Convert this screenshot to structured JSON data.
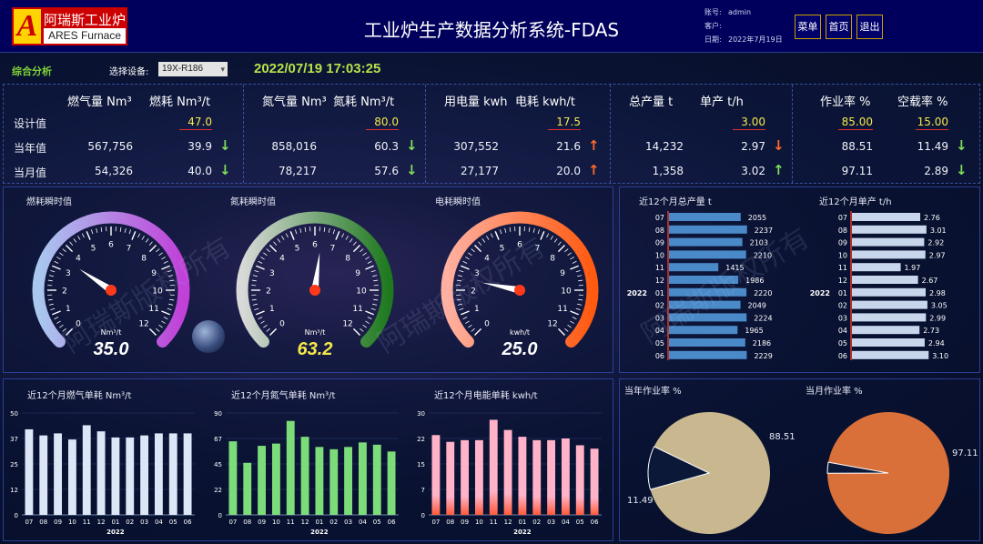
{
  "header": {
    "logo_char": "A",
    "logo_cn": "阿瑞斯工业炉",
    "logo_en": "ARES Furnace",
    "title": "工业炉生产数据分析系统-FDAS",
    "account_label": "账号:",
    "account": "admin",
    "client_label": "客户:",
    "client": "",
    "date_label": "日期:",
    "date": "2022年7月19日",
    "buttons": [
      "菜单",
      "首页",
      "退出"
    ]
  },
  "toolbar": {
    "section": "综合分析",
    "select_label": "选择设备:",
    "device": "19X-R186",
    "datetime": "2022/07/19 17:03:25"
  },
  "summary": {
    "row_labels": [
      "设计值",
      "当年值",
      "当月值"
    ],
    "groups": [
      {
        "h1": "燃气量 Nm³",
        "h2": "燃耗 Nm³/t",
        "design": "47.0",
        "year_q": "567,756",
        "year_r": "39.9",
        "year_dir": "down",
        "month_q": "54,326",
        "month_r": "40.0",
        "month_dir": "down"
      },
      {
        "h1": "氮气量 Nm³",
        "h2": "氮耗 Nm³/t",
        "design": "80.0",
        "year_q": "858,016",
        "year_r": "60.3",
        "year_dir": "down",
        "month_q": "78,217",
        "month_r": "57.6",
        "month_dir": "down"
      },
      {
        "h1": "用电量 kwh",
        "h2": "电耗 kwh/t",
        "design": "17.5",
        "year_q": "307,552",
        "year_r": "21.6",
        "year_dir": "up",
        "month_q": "27,177",
        "month_r": "20.0",
        "month_dir": "up"
      },
      {
        "h1": "总产量 t",
        "h2": "单产 t/h",
        "design": "3.00",
        "year_q": "14,232",
        "year_r": "2.97",
        "year_dir": "down_red",
        "month_q": "1,358",
        "month_r": "3.02",
        "month_dir": "up_green"
      },
      {
        "h1": "作业率 %",
        "h2": "空载率 %",
        "design_a": "85.00",
        "design": "15.00",
        "year_q": "88.51",
        "year_r": "11.49",
        "year_dir": "down",
        "month_q": "97.11",
        "month_r": "2.89",
        "month_dir": "down"
      }
    ]
  },
  "gauges": [
    {
      "title": "燃耗瞬时值",
      "unit": "Nm³/t",
      "value": 35.0,
      "display": "35.0",
      "max": 120,
      "ticks": [
        "0",
        "1",
        "2",
        "3",
        "4",
        "5",
        "6",
        "7",
        "8",
        "9",
        "10",
        "11",
        "12"
      ],
      "color_start": "#a9c8ef",
      "color_end": "#c040d8",
      "value_color": "#ffffff"
    },
    {
      "title": "氮耗瞬时值",
      "unit": "Nm³/t",
      "value": 63.2,
      "display": "63.2",
      "max": 120,
      "ticks": [
        "0",
        "1",
        "2",
        "3",
        "4",
        "5",
        "6",
        "7",
        "8",
        "9",
        "10",
        "11",
        "12"
      ],
      "color_start": "#d9d9d9",
      "color_end": "#1f7a1f",
      "value_color": "#f5e84a"
    },
    {
      "title": "电耗瞬时值",
      "unit": "kwh/t",
      "value": 25.0,
      "display": "25.0",
      "max": 120,
      "ticks": [
        "0",
        "1",
        "2",
        "3",
        "4",
        "5",
        "6",
        "7",
        "8",
        "9",
        "10",
        "11",
        "12"
      ],
      "color_start": "#ffb0a0",
      "color_end": "#ff5a10",
      "value_color": "#ffffff"
    }
  ],
  "hbar": {
    "months": [
      "07",
      "08",
      "09",
      "10",
      "11",
      "12",
      "01",
      "02",
      "03",
      "04",
      "05",
      "06"
    ],
    "year_label": "2022",
    "total": {
      "title": "近12个月总产量 t",
      "values": [
        2055,
        2237,
        2103,
        2210,
        1415,
        1986,
        2220,
        2049,
        2224,
        1965,
        2186,
        2229
      ],
      "labels": [
        "2055",
        "2237",
        "2103",
        "2210",
        "1415",
        "1986",
        "2220",
        "2049",
        "2224",
        "1965",
        "2186",
        "2229"
      ],
      "max": 2400
    },
    "unit": {
      "title": "近12个月单产 t/h",
      "values": [
        2.76,
        3.01,
        2.92,
        2.97,
        1.97,
        2.67,
        2.98,
        3.05,
        2.99,
        2.73,
        2.94,
        3.1
      ],
      "labels": [
        "2.76",
        "3.01",
        "2.92",
        "2.97",
        "1.97",
        "2.67",
        "2.98",
        "3.05",
        "2.99",
        "2.73",
        "2.94",
        "3.10"
      ],
      "max": 3.2
    }
  },
  "chart_data": [
    {
      "type": "bar",
      "title": "近12个月燃气单耗 Nm³/t",
      "categories": [
        "07",
        "08",
        "09",
        "10",
        "11",
        "12",
        "01",
        "02",
        "03",
        "04",
        "05",
        "06"
      ],
      "values": [
        42,
        39,
        40,
        37,
        44,
        41,
        38,
        38,
        39,
        40,
        40,
        40
      ],
      "ylim": [
        0,
        50
      ],
      "yticks": [
        "0",
        "12",
        "25",
        "37",
        "50"
      ],
      "xgroup": "2022",
      "color": "#dce6f7"
    },
    {
      "type": "bar",
      "title": "近12个月氮气单耗 Nm³/t",
      "categories": [
        "07",
        "08",
        "09",
        "10",
        "11",
        "12",
        "01",
        "02",
        "03",
        "04",
        "05",
        "06"
      ],
      "values": [
        65,
        46,
        61,
        63,
        83,
        69,
        60,
        58,
        60,
        64,
        62,
        56
      ],
      "ylim": [
        0,
        90
      ],
      "yticks": [
        "0",
        "22",
        "45",
        "67",
        "90"
      ],
      "xgroup": "2022",
      "color": "#7ddc7a"
    },
    {
      "type": "bar",
      "title": "近12个月电能单耗 kwh/t",
      "categories": [
        "07",
        "08",
        "09",
        "10",
        "11",
        "12",
        "01",
        "02",
        "03",
        "04",
        "05",
        "06"
      ],
      "values": [
        23.5,
        21.5,
        22,
        22,
        28,
        25,
        23,
        22,
        22,
        22.5,
        20.5,
        19.5
      ],
      "ylim": [
        0,
        30
      ],
      "yticks": [
        "0",
        "7",
        "15",
        "22",
        "30"
      ],
      "xgroup": "2022",
      "color": "#ffb3c8"
    },
    {
      "type": "pie",
      "title": "当年作业率 %",
      "values": [
        88.51,
        11.49
      ],
      "labels": [
        "88.51",
        "11.49"
      ],
      "colors": [
        "#c9b88f",
        "#0b1838"
      ]
    },
    {
      "type": "pie",
      "title": "当月作业率 %",
      "values": [
        97.11,
        2.89
      ],
      "labels": [
        "97.11",
        ""
      ],
      "colors": [
        "#d9703a",
        "#0b1838"
      ]
    }
  ],
  "watermark": "阿瑞斯版权所有"
}
